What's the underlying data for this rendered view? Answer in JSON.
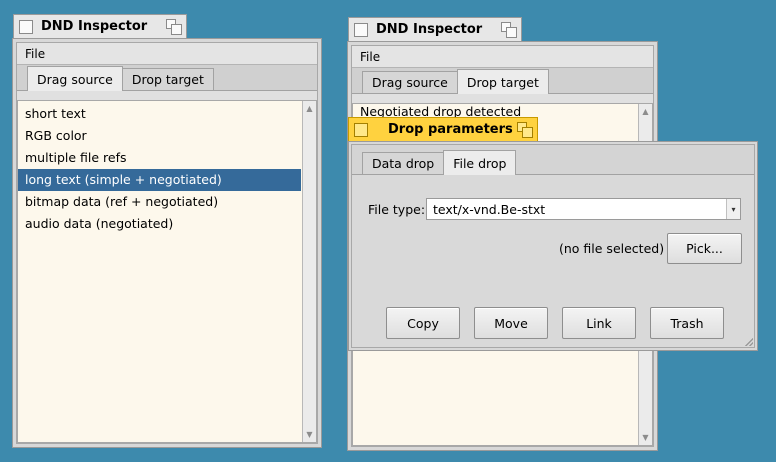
{
  "left_window": {
    "title": "DND Inspector",
    "menu": [
      "File"
    ],
    "tabs": [
      "Drag source",
      "Drop target"
    ],
    "selected_tab": "Drag source",
    "list_items": [
      {
        "label": "short text",
        "selected": false
      },
      {
        "label": "RGB color",
        "selected": false
      },
      {
        "label": "multiple file refs",
        "selected": false
      },
      {
        "label": "long text (simple + negotiated)",
        "selected": true
      },
      {
        "label": "bitmap data (ref + negotiated)",
        "selected": false
      },
      {
        "label": "audio data (negotiated)",
        "selected": false
      }
    ]
  },
  "right_window": {
    "title": "DND Inspector",
    "menu": [
      "File"
    ],
    "tabs": [
      "Drag source",
      "Drop target"
    ],
    "selected_tab": "Drop target",
    "log_text": "Negotiated drop detected"
  },
  "dialog": {
    "title": "Drop parameters",
    "tabs": [
      "Data drop",
      "File drop"
    ],
    "selected_tab": "File drop",
    "file_type_label": "File type:",
    "file_type_value": "text/x-vnd.Be-stxt",
    "no_file_text": "(no file selected)",
    "pick_label": "Pick...",
    "buttons": [
      "Copy",
      "Move",
      "Link",
      "Trash"
    ]
  },
  "colors": {
    "desktop": "#3d8aad",
    "active_tab": "#ffd23f",
    "selection": "#356a9a",
    "list_background": "#fdf8ec"
  }
}
